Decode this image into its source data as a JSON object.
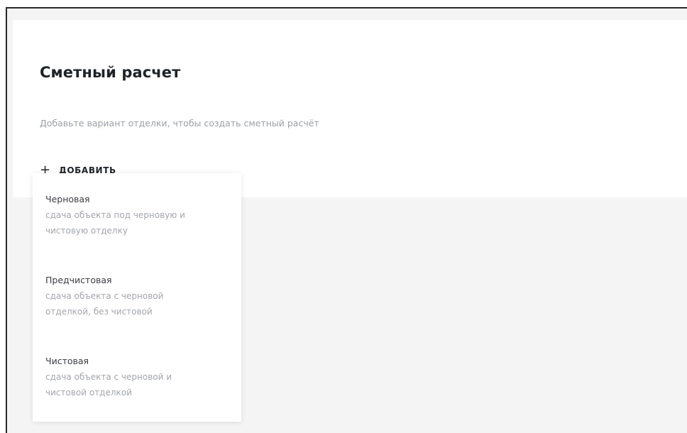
{
  "estimate": {
    "title": "Сметный расчет",
    "hint": "Добавьте вариант отделки, чтобы создать сметный расчёт",
    "add_button": {
      "icon": "plus-icon",
      "plus": "+",
      "label": "ДОБАВИТЬ"
    }
  },
  "dropdown": {
    "options": [
      {
        "title": "Черновая",
        "desc_line1": "сдача объекта под черновую и",
        "desc_line2": "чистовую отделку"
      },
      {
        "title": "Предчистовая",
        "desc_line1": "сдача объекта с черновой",
        "desc_line2": "отделкой, без чистовой"
      },
      {
        "title": "Чистовая",
        "desc_line1": "сдача объекта с черновой и",
        "desc_line2": "чистовой отделкой"
      }
    ]
  }
}
